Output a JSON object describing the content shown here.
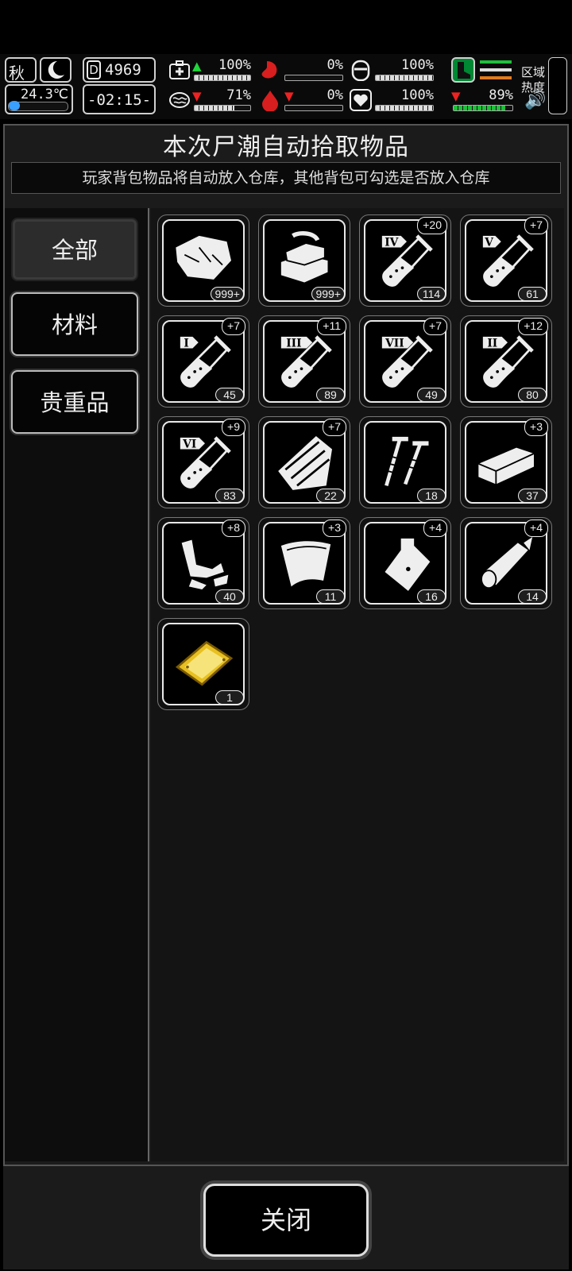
{
  "hud": {
    "season": "秋",
    "temperature": "24.3℃",
    "day": "4969",
    "clock": "-02:15-",
    "stats": [
      {
        "name": "health",
        "icon": "medkit-icon",
        "trend": "up",
        "value": "100%",
        "fill": 1.0
      },
      {
        "name": "hunger",
        "icon": "stomach-icon",
        "trend": "",
        "value": "0%",
        "fill": 0
      },
      {
        "name": "armor",
        "icon": "helmet-icon",
        "trend": "",
        "value": "100%",
        "fill": 1.0
      },
      {
        "name": "brain",
        "icon": "brain-icon",
        "trend": "down",
        "value": "71%",
        "fill": 0.71
      },
      {
        "name": "blood",
        "icon": "blood-drop-icon",
        "trend": "down",
        "value": "0%",
        "fill": 0
      },
      {
        "name": "mood",
        "icon": "heart-icon",
        "trend": "",
        "value": "100%",
        "fill": 1.0
      },
      {
        "name": "stamina",
        "icon": "boot-icon",
        "trend": "down",
        "value": "89%",
        "fill": 0.89
      }
    ],
    "zone_heat_label_1": "区域",
    "zone_heat_label_2": "热度"
  },
  "dialog": {
    "title": "本次尸潮自动拾取物品",
    "subtitle": "玩家背包物品将自动放入仓库，其他背包可勾选是否放入仓库",
    "close_label": "关闭"
  },
  "tabs": [
    {
      "label": "全部",
      "active": true
    },
    {
      "label": "材料",
      "active": false
    },
    {
      "label": "贵重品",
      "active": false
    }
  ],
  "items": [
    {
      "icon": "cloth-scrap-icon",
      "count": "999+",
      "plus": ""
    },
    {
      "icon": "folded-cloth-icon",
      "count": "999+",
      "plus": ""
    },
    {
      "icon": "test-tube-icon",
      "roman": "IV",
      "count": "114",
      "plus": "+20"
    },
    {
      "icon": "test-tube-icon",
      "roman": "V",
      "count": "61",
      "plus": "+7"
    },
    {
      "icon": "test-tube-icon",
      "roman": "I",
      "count": "45",
      "plus": "+7"
    },
    {
      "icon": "test-tube-icon",
      "roman": "III",
      "count": "89",
      "plus": "+11"
    },
    {
      "icon": "test-tube-icon",
      "roman": "VII",
      "count": "49",
      "plus": "+7"
    },
    {
      "icon": "test-tube-icon",
      "roman": "II",
      "count": "80",
      "plus": "+12"
    },
    {
      "icon": "test-tube-icon",
      "roman": "VI",
      "count": "83",
      "plus": "+9"
    },
    {
      "icon": "wood-planks-icon",
      "count": "22",
      "plus": "+7"
    },
    {
      "icon": "nails-icon",
      "count": "18",
      "plus": ""
    },
    {
      "icon": "brick-icon",
      "count": "37",
      "plus": "+3"
    },
    {
      "icon": "scrap-metal-icon",
      "count": "40",
      "plus": "+8"
    },
    {
      "icon": "metal-sheet-icon",
      "count": "11",
      "plus": "+3"
    },
    {
      "icon": "pouch-icon",
      "count": "16",
      "plus": "+4"
    },
    {
      "icon": "pipe-icon",
      "count": "14",
      "plus": "+4"
    },
    {
      "icon": "gold-plate-icon",
      "count": "1",
      "plus": ""
    }
  ]
}
